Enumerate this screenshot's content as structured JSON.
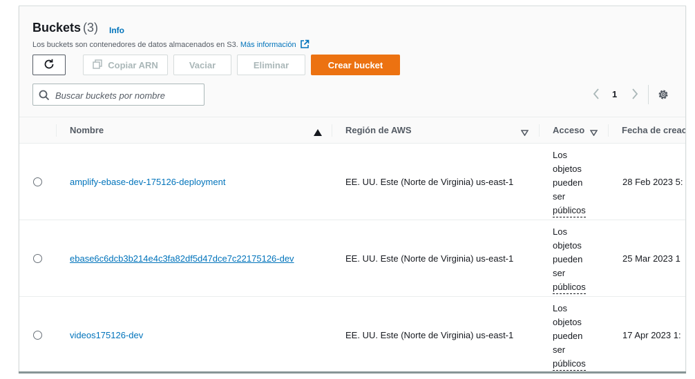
{
  "header": {
    "title": "Buckets",
    "count": "(3)",
    "info_label": "Info",
    "description": "Los buckets son contenedores de datos almacenados en S3.",
    "learn_more": "Más información"
  },
  "toolbar": {
    "refresh_icon": "refresh-icon",
    "copy_arn_label": "Copiar ARN",
    "empty_label": "Vaciar",
    "delete_label": "Eliminar",
    "create_label": "Crear bucket",
    "accent_color": "#ec7211"
  },
  "search": {
    "placeholder": "Buscar buckets por nombre",
    "value": ""
  },
  "pagination": {
    "current_page": "1"
  },
  "table": {
    "columns": [
      "Nombre",
      "Región de AWS",
      "Acceso",
      "Fecha de creac"
    ],
    "sort": {
      "column": "Nombre",
      "direction": "ascending"
    },
    "rows": [
      {
        "name": "amplify-ebase-dev-175126-deployment",
        "region": "EE. UU. Este (Norte de Virginia) us-east-1",
        "access_lines": [
          "Los",
          "objetos",
          "pueden",
          "ser",
          "públicos"
        ],
        "created": "28 Feb 2023 5:"
      },
      {
        "name": "ebase6c6dcb3b214e4c3fa82df5d47dce7c22175126-dev",
        "region": "EE. UU. Este (Norte de Virginia) us-east-1",
        "access_lines": [
          "Los",
          "objetos",
          "pueden",
          "ser",
          "públicos"
        ],
        "created": "25 Mar 2023 1"
      },
      {
        "name": "videos175126-dev",
        "region": "EE. UU. Este (Norte de Virginia) us-east-1",
        "access_lines": [
          "Los",
          "objetos",
          "pueden",
          "ser",
          "públicos"
        ],
        "created": "17 Apr 2023 1:"
      }
    ]
  },
  "colors": {
    "link": "#0073bb",
    "text": "#16191f",
    "muted": "#545b64",
    "border": "#d5dbdb",
    "disabled": "#aab7b8"
  }
}
